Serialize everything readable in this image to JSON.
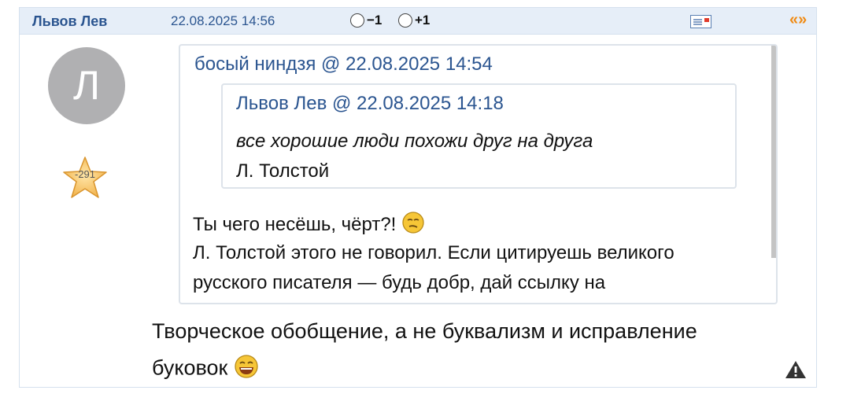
{
  "header": {
    "author": "Львов Лев",
    "date": "22.08.2025 14:56",
    "vote_minus": "−1",
    "vote_plus": "+1",
    "nav_symbol": "«»"
  },
  "avatar": {
    "letter": "Л",
    "rating": "-291"
  },
  "quote": {
    "header": "босый ниндзя @ 22.08.2025 14:54",
    "nested": {
      "header": "Львов Лев @ 22.08.2025 14:18",
      "line1": "все хорошие люди похожи друг на друга",
      "line2": "Л. Толстой"
    },
    "body": [
      "Ты чего несёшь, чёрт?!",
      "Л. Толстой этого не говорил. Если цитируешь великого",
      "русского писателя — будь добр, дай ссылку на"
    ]
  },
  "message": {
    "line1": "Творческое обобщение, а не буквализм и исправление",
    "line2": "буковок"
  },
  "icons": [
    "mail-icon",
    "nav-arrows-icon",
    "star-icon",
    "smirk-smiley-icon",
    "laugh-smiley-icon",
    "warning-icon"
  ],
  "colors": {
    "header_bg": "#e6eef8",
    "link": "#2b5590",
    "accent": "#f08a12",
    "avatar_bg": "#b0b0b2"
  }
}
